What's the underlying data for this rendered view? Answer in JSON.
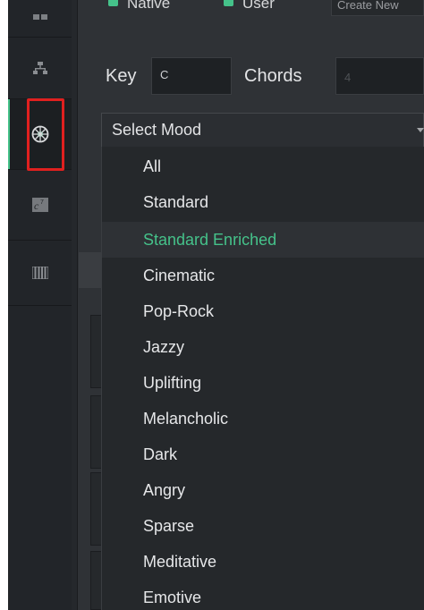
{
  "top_bar": {
    "native_label": "Native",
    "user_label": "User",
    "create_new_text": "Create New"
  },
  "sidebar": {
    "items": [
      {
        "icon": "grid-icon"
      },
      {
        "icon": "hierarchy-icon"
      },
      {
        "icon": "mood-wheel-icon",
        "active": true
      },
      {
        "icon": "chord-c7-icon"
      },
      {
        "icon": "piano-keys-icon"
      }
    ]
  },
  "key": {
    "label": "Key",
    "value": "C"
  },
  "chords": {
    "label": "Chords",
    "placeholder": "4"
  },
  "mood_select": {
    "label": "Select Mood",
    "options": [
      "All",
      "Standard",
      "Standard Enriched",
      "Cinematic",
      "Pop-Rock",
      "Jazzy",
      "Uplifting",
      "Melancholic",
      "Dark",
      "Angry",
      "Sparse",
      "Meditative",
      "Emotive"
    ],
    "selected": "Standard Enriched"
  },
  "colors": {
    "accent": "#45c28a",
    "highlight_box": "#e0201f",
    "sidebar_bg": "#222529",
    "main_bg": "#2f3236",
    "dropdown_bg": "#25282b"
  }
}
